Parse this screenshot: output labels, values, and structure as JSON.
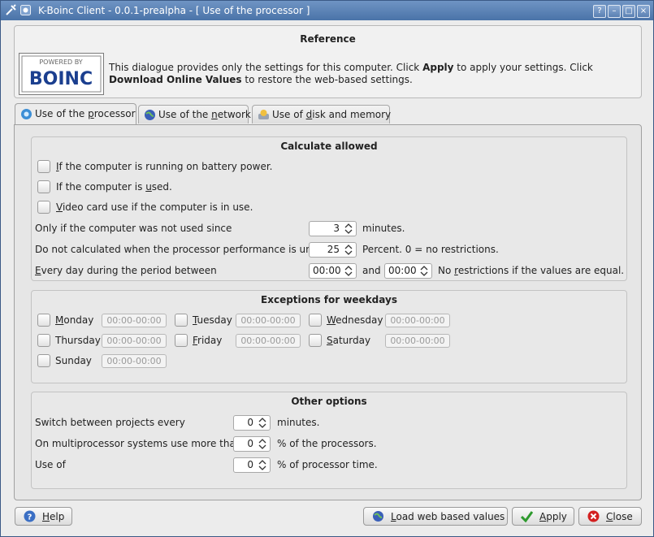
{
  "window": {
    "title": "K-Boinc Client - 0.0.1-prealpha - [ Use of the processor ]"
  },
  "titlebar_buttons": {
    "help": "?",
    "minimize": "–",
    "maximize": "□",
    "close": "×"
  },
  "reference": {
    "title": "Reference",
    "logo_top": "POWERED BY",
    "logo_main": "BOINC",
    "text_1": "This dialogue provides only the settings for this computer. Click ",
    "apply_word": "Apply",
    "text_2": " to apply your settings. Click ",
    "download_words": "Download Online Values",
    "text_3": " to restore the web-based settings."
  },
  "tabs": [
    {
      "label_pre": "Use of the ",
      "label_u": "p",
      "label_post": "rocessor",
      "active": true
    },
    {
      "label_pre": "Use of the ",
      "label_u": "n",
      "label_post": "etwork",
      "active": false
    },
    {
      "label_pre": "Use of ",
      "label_u": "d",
      "label_post": "isk and memory",
      "active": false
    }
  ],
  "calc": {
    "title": "Calculate allowed",
    "battery_u": "I",
    "battery_rest": "f the computer is running on battery power.",
    "used_pre": "If the computer is ",
    "used_u": "u",
    "used_post": "sed.",
    "video_u": "V",
    "video_rest": "ideo card use if the computer is in use.",
    "notused_label": "Only if the computer was not used since",
    "notused_value": "3",
    "notused_unit": "minutes.",
    "perf_label": "Do not calculated when the processor performance is under",
    "perf_value": "25",
    "perf_unit": "Percent. 0 = no restrictions.",
    "period_u": "E",
    "period_rest": "very day during the period between",
    "period_start": "00:00",
    "period_and": "and",
    "period_end": "00:00",
    "period_note_pre": "No ",
    "period_note_u": "r",
    "period_note_post": "estrictions if the values are equal."
  },
  "weekdays": {
    "title": "Exceptions for weekdays",
    "days": [
      {
        "u": "M",
        "rest": "onday",
        "range": "00:00-00:00"
      },
      {
        "u": "T",
        "rest": "uesday",
        "range": "00:00-00:00"
      },
      {
        "u": "W",
        "rest": "ednesday",
        "range": "00:00-00:00"
      },
      {
        "u": "",
        "rest": "Thursday",
        "range": "00:00-00:00"
      },
      {
        "u": "F",
        "rest": "riday",
        "range": "00:00-00:00"
      },
      {
        "u": "S",
        "rest": "aturday",
        "range": "00:00-00:00"
      },
      {
        "u": "",
        "rest": "Sunday",
        "range": "00:00-00:00"
      }
    ]
  },
  "other": {
    "title": "Other options",
    "switch_label": "Switch between projects every",
    "switch_value": "0",
    "switch_unit": "minutes.",
    "multi_label": "On multiprocessor systems use more than",
    "multi_value": "0",
    "multi_unit": "% of the processors.",
    "useof_label": "Use of",
    "useof_value": "0",
    "useof_unit": "% of processor time."
  },
  "buttons": {
    "help_u": "H",
    "help_rest": "elp",
    "load_u": "L",
    "load_rest": "oad web based values",
    "apply_u": "A",
    "apply_rest": "pply",
    "close_u": "C",
    "close_rest": "lose"
  },
  "colors": {
    "titlebar": "#4a73a8",
    "apply_check": "#2e9a2e",
    "close_icon": "#d32020",
    "help_icon": "#3b6fc4"
  }
}
